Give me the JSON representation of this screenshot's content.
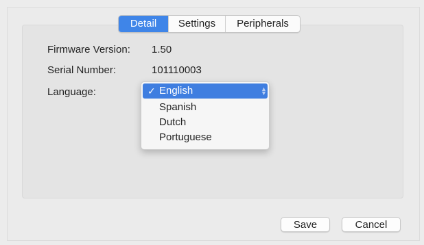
{
  "tabs": [
    {
      "label": "Detail",
      "active": true
    },
    {
      "label": "Settings",
      "active": false
    },
    {
      "label": "Peripherals",
      "active": false
    }
  ],
  "detail": {
    "firmware_label": "Firmware Version:",
    "firmware_value": "1.50",
    "serial_label": "Serial Number:",
    "serial_value": "101110003",
    "language_label": "Language:"
  },
  "language_dropdown": {
    "selected": "English",
    "check_glyph": "✓",
    "options": [
      "English",
      "Spanish",
      "Dutch",
      "Portuguese"
    ]
  },
  "buttons": {
    "save_label": "Save",
    "cancel_label": "Cancel"
  },
  "colors": {
    "accent": "#3f85e8",
    "background": "#ebebeb"
  }
}
